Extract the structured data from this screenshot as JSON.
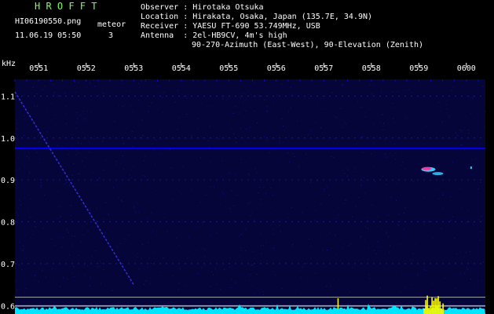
{
  "header": {
    "app_title": "H R O F F T",
    "file_name": "HI06190550.png",
    "timestamp": "11.06.19 05:50",
    "event_label": "meteor",
    "event_count": "3"
  },
  "station": [
    {
      "key": "Observer",
      "value": "Hirotaka Otsuka"
    },
    {
      "key": "Location",
      "value": "Hirakata, Osaka, Japan (135.7E, 34.9N)"
    },
    {
      "key": "Receiver",
      "value": "YAESU FT-690 53.749MHz, USB"
    },
    {
      "key": "Antenna ",
      "value": "2el-HB9CV, 4m's high"
    },
    {
      "key": "",
      "value": "90-270-Azimuth (East-West), 90-Elevation (Zenith)"
    }
  ],
  "colors": {
    "background": "#000000",
    "plot_background": "#05053a",
    "noise_line": "#0000ff",
    "spectrum": "#00e5ff",
    "title": "#7CFF5A",
    "echo_hot": "#ff3399",
    "echo_cool": "#33ccff",
    "burst": "#ffff00"
  },
  "chart_data": {
    "type": "heatmap",
    "title": "",
    "xlabel": "",
    "ylabel": "kHz",
    "x_ticks": [
      "0551",
      "0552",
      "0553",
      "0554",
      "0555",
      "0556",
      "0557",
      "0558",
      "0559",
      "0600"
    ],
    "x_range_min": [
      50.5,
      60.4
    ],
    "y_ticks": [
      1.1,
      1.0,
      0.9,
      0.8,
      0.7,
      0.6
    ],
    "ylim": [
      0.58,
      1.14
    ],
    "carrier_khz": 0.975,
    "sweep_line": {
      "start": {
        "t_min": 50.5,
        "khz": 1.11
      },
      "end": {
        "t_min": 53.0,
        "khz": 0.65
      }
    },
    "meteor_echoes": [
      {
        "t_min": 59.2,
        "khz": 0.925,
        "strength": "strong"
      },
      {
        "t_min": 59.4,
        "khz": 0.915,
        "strength": "medium"
      },
      {
        "t_min": 60.1,
        "khz": 0.93,
        "strength": "weak"
      }
    ],
    "burst_interval_min": [
      59.1,
      59.5
    ],
    "marker_t_min": 57.3,
    "reference_lines_khz": [
      0.62,
      0.6
    ]
  }
}
